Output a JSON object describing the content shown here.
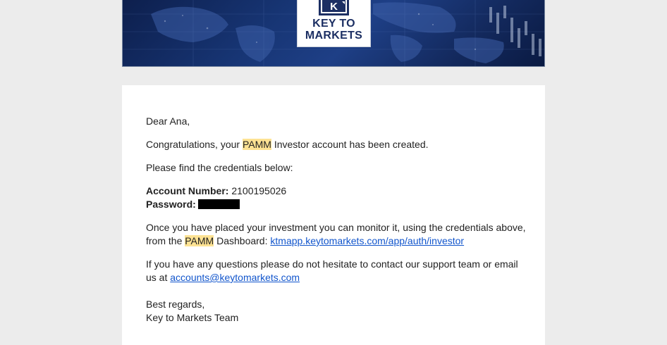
{
  "banner": {
    "logo_line1": "KEY TO",
    "logo_line2": "MARKETS",
    "logo_icon": "k-logo-icon",
    "colors": {
      "banner_dark": "#0d1f4d",
      "banner_mid": "#1e3f86",
      "logo_text": "#1c2f63"
    }
  },
  "email": {
    "greeting": "Dear Ana,",
    "congrats_pre": "Congratulations, your ",
    "pamm_1": "PAMM",
    "congrats_post": " Investor account has been created.",
    "find_credentials": "Please find the credentials below:",
    "account_number_label": "Account Number:",
    "account_number_value": "2100195026",
    "password_label": "Password:",
    "monitor_pre": "Once you have placed your investment you can monitor it, using the credentials above, from the ",
    "pamm_2": "PAMM",
    "monitor_mid": " Dashboard: ",
    "dashboard_link": "ktmapp.keytomarkets.com/app/auth/investor",
    "questions_pre": "If you have any questions please do not hesitate to contact our support team or email us at ",
    "support_email": "accounts@keytomarkets.com",
    "regards": "Best regards,",
    "signature": "Key to Markets Team",
    "colors": {
      "highlight": "#fde293",
      "link": "#1155cc",
      "page_bg": "#ececec"
    }
  }
}
